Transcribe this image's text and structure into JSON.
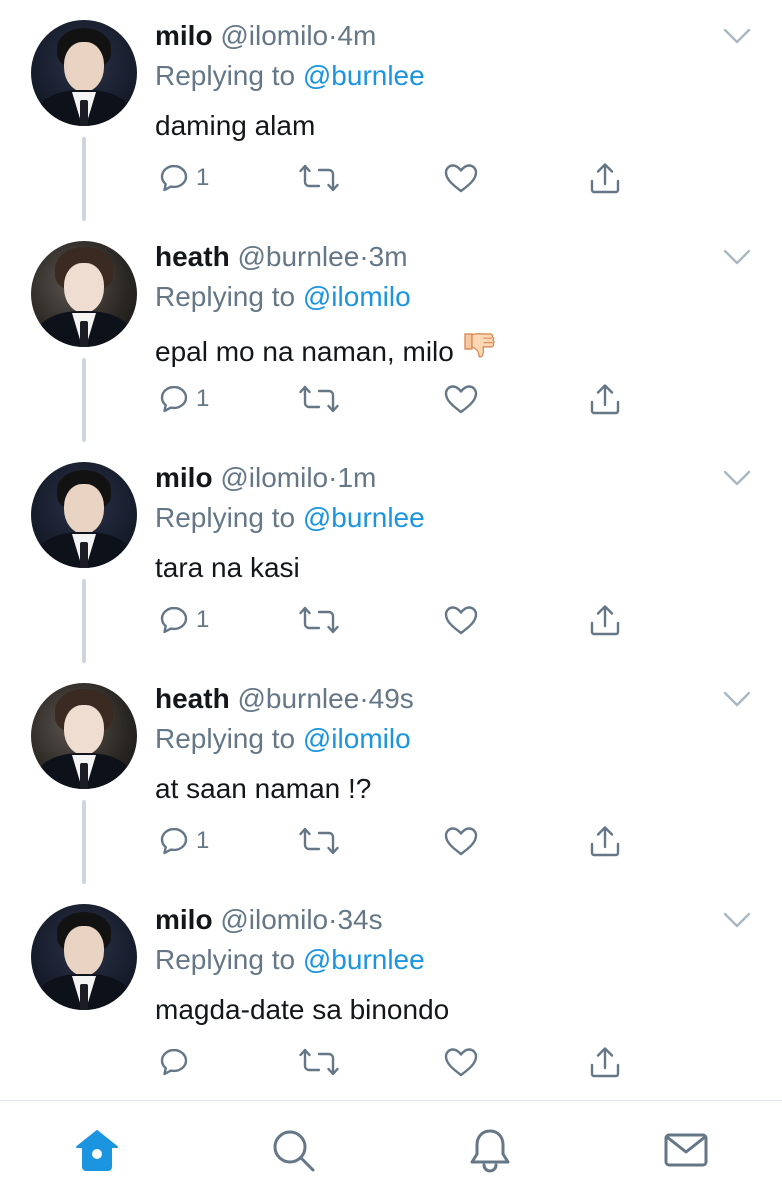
{
  "colors": {
    "accent": "#1b95e0",
    "text_primary": "#14171a",
    "text_secondary": "#657786",
    "thread_line": "#cdd5df",
    "divider": "#dfe4e9"
  },
  "tweets": [
    {
      "name": "milo",
      "handle": "@ilomilo",
      "separator": "·",
      "time": "4m",
      "replying_prefix": "Replying to",
      "replying_handle": "@burnlee",
      "text": "daming alam",
      "reply_count": "1",
      "avatar": "milo-avatar"
    },
    {
      "name": "heath",
      "handle": "@burnlee",
      "separator": "·",
      "time": "3m",
      "replying_prefix": "Replying to",
      "replying_handle": "@ilomilo",
      "text": "epal mo na naman, milo",
      "emoji": "thumbs-down-emoji",
      "reply_count": "1",
      "avatar": "heath-avatar"
    },
    {
      "name": "milo",
      "handle": "@ilomilo",
      "separator": "·",
      "time": "1m",
      "replying_prefix": "Replying to",
      "replying_handle": "@burnlee",
      "text": "tara na kasi",
      "reply_count": "1",
      "avatar": "milo-avatar"
    },
    {
      "name": "heath",
      "handle": "@burnlee",
      "separator": "·",
      "time": "49s",
      "replying_prefix": "Replying to",
      "replying_handle": "@ilomilo",
      "text": "at saan naman !?",
      "reply_count": "1",
      "avatar": "heath-avatar"
    },
    {
      "name": "milo",
      "handle": "@ilomilo",
      "separator": "·",
      "time": "34s",
      "replying_prefix": "Replying to",
      "replying_handle": "@burnlee",
      "text": "magda-date sa binondo",
      "reply_count": "",
      "avatar": "milo-avatar"
    }
  ],
  "tabbar": {
    "items": [
      "home-icon",
      "search-icon",
      "notifications-icon",
      "messages-icon"
    ],
    "active": "home"
  }
}
